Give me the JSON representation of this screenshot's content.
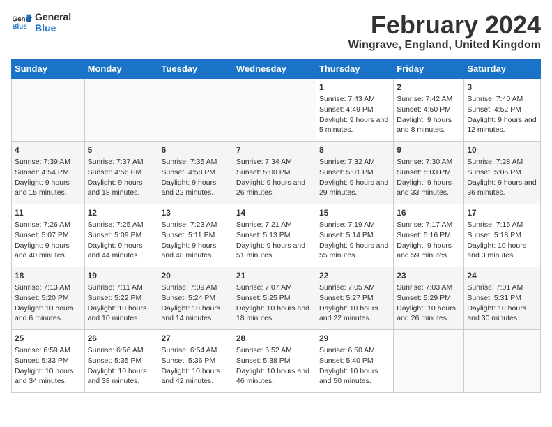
{
  "header": {
    "logo_line1": "General",
    "logo_line2": "Blue",
    "month_year": "February 2024",
    "location": "Wingrave, England, United Kingdom"
  },
  "days_of_week": [
    "Sunday",
    "Monday",
    "Tuesday",
    "Wednesday",
    "Thursday",
    "Friday",
    "Saturday"
  ],
  "weeks": [
    [
      {
        "day": "",
        "content": ""
      },
      {
        "day": "",
        "content": ""
      },
      {
        "day": "",
        "content": ""
      },
      {
        "day": "",
        "content": ""
      },
      {
        "day": "1",
        "content": "Sunrise: 7:43 AM\nSunset: 4:49 PM\nDaylight: 9 hours and 5 minutes."
      },
      {
        "day": "2",
        "content": "Sunrise: 7:42 AM\nSunset: 4:50 PM\nDaylight: 9 hours and 8 minutes."
      },
      {
        "day": "3",
        "content": "Sunrise: 7:40 AM\nSunset: 4:52 PM\nDaylight: 9 hours and 12 minutes."
      }
    ],
    [
      {
        "day": "4",
        "content": "Sunrise: 7:39 AM\nSunset: 4:54 PM\nDaylight: 9 hours and 15 minutes."
      },
      {
        "day": "5",
        "content": "Sunrise: 7:37 AM\nSunset: 4:56 PM\nDaylight: 9 hours and 18 minutes."
      },
      {
        "day": "6",
        "content": "Sunrise: 7:35 AM\nSunset: 4:58 PM\nDaylight: 9 hours and 22 minutes."
      },
      {
        "day": "7",
        "content": "Sunrise: 7:34 AM\nSunset: 5:00 PM\nDaylight: 9 hours and 26 minutes."
      },
      {
        "day": "8",
        "content": "Sunrise: 7:32 AM\nSunset: 5:01 PM\nDaylight: 9 hours and 29 minutes."
      },
      {
        "day": "9",
        "content": "Sunrise: 7:30 AM\nSunset: 5:03 PM\nDaylight: 9 hours and 33 minutes."
      },
      {
        "day": "10",
        "content": "Sunrise: 7:28 AM\nSunset: 5:05 PM\nDaylight: 9 hours and 36 minutes."
      }
    ],
    [
      {
        "day": "11",
        "content": "Sunrise: 7:26 AM\nSunset: 5:07 PM\nDaylight: 9 hours and 40 minutes."
      },
      {
        "day": "12",
        "content": "Sunrise: 7:25 AM\nSunset: 5:09 PM\nDaylight: 9 hours and 44 minutes."
      },
      {
        "day": "13",
        "content": "Sunrise: 7:23 AM\nSunset: 5:11 PM\nDaylight: 9 hours and 48 minutes."
      },
      {
        "day": "14",
        "content": "Sunrise: 7:21 AM\nSunset: 5:13 PM\nDaylight: 9 hours and 51 minutes."
      },
      {
        "day": "15",
        "content": "Sunrise: 7:19 AM\nSunset: 5:14 PM\nDaylight: 9 hours and 55 minutes."
      },
      {
        "day": "16",
        "content": "Sunrise: 7:17 AM\nSunset: 5:16 PM\nDaylight: 9 hours and 59 minutes."
      },
      {
        "day": "17",
        "content": "Sunrise: 7:15 AM\nSunset: 5:18 PM\nDaylight: 10 hours and 3 minutes."
      }
    ],
    [
      {
        "day": "18",
        "content": "Sunrise: 7:13 AM\nSunset: 5:20 PM\nDaylight: 10 hours and 6 minutes."
      },
      {
        "day": "19",
        "content": "Sunrise: 7:11 AM\nSunset: 5:22 PM\nDaylight: 10 hours and 10 minutes."
      },
      {
        "day": "20",
        "content": "Sunrise: 7:09 AM\nSunset: 5:24 PM\nDaylight: 10 hours and 14 minutes."
      },
      {
        "day": "21",
        "content": "Sunrise: 7:07 AM\nSunset: 5:25 PM\nDaylight: 10 hours and 18 minutes."
      },
      {
        "day": "22",
        "content": "Sunrise: 7:05 AM\nSunset: 5:27 PM\nDaylight: 10 hours and 22 minutes."
      },
      {
        "day": "23",
        "content": "Sunrise: 7:03 AM\nSunset: 5:29 PM\nDaylight: 10 hours and 26 minutes."
      },
      {
        "day": "24",
        "content": "Sunrise: 7:01 AM\nSunset: 5:31 PM\nDaylight: 10 hours and 30 minutes."
      }
    ],
    [
      {
        "day": "25",
        "content": "Sunrise: 6:59 AM\nSunset: 5:33 PM\nDaylight: 10 hours and 34 minutes."
      },
      {
        "day": "26",
        "content": "Sunrise: 6:56 AM\nSunset: 5:35 PM\nDaylight: 10 hours and 38 minutes."
      },
      {
        "day": "27",
        "content": "Sunrise: 6:54 AM\nSunset: 5:36 PM\nDaylight: 10 hours and 42 minutes."
      },
      {
        "day": "28",
        "content": "Sunrise: 6:52 AM\nSunset: 5:38 PM\nDaylight: 10 hours and 46 minutes."
      },
      {
        "day": "29",
        "content": "Sunrise: 6:50 AM\nSunset: 5:40 PM\nDaylight: 10 hours and 50 minutes."
      },
      {
        "day": "",
        "content": ""
      },
      {
        "day": "",
        "content": ""
      }
    ]
  ]
}
